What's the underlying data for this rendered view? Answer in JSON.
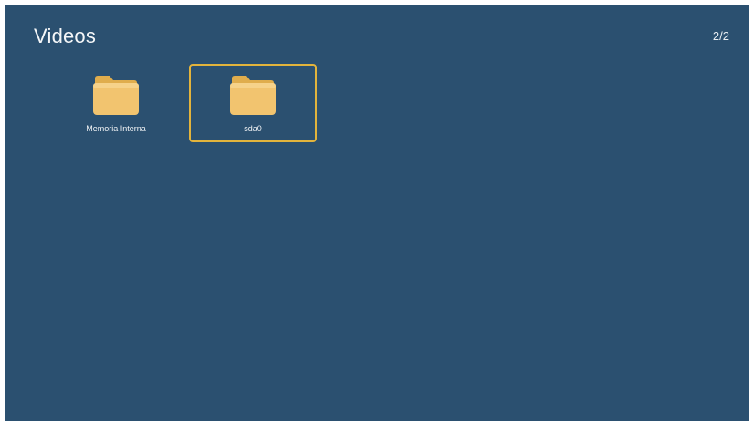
{
  "header": {
    "title": "Videos",
    "page_indicator": "2/2"
  },
  "items": [
    {
      "label": "Memoria Interna",
      "icon": "folder-icon",
      "selected": false
    },
    {
      "label": "sda0",
      "icon": "folder-icon",
      "selected": true
    }
  ],
  "colors": {
    "background": "#2b5070",
    "folder": "#f2c46f",
    "folder_tab": "#e3b04f",
    "selection": "#e3b43c"
  }
}
